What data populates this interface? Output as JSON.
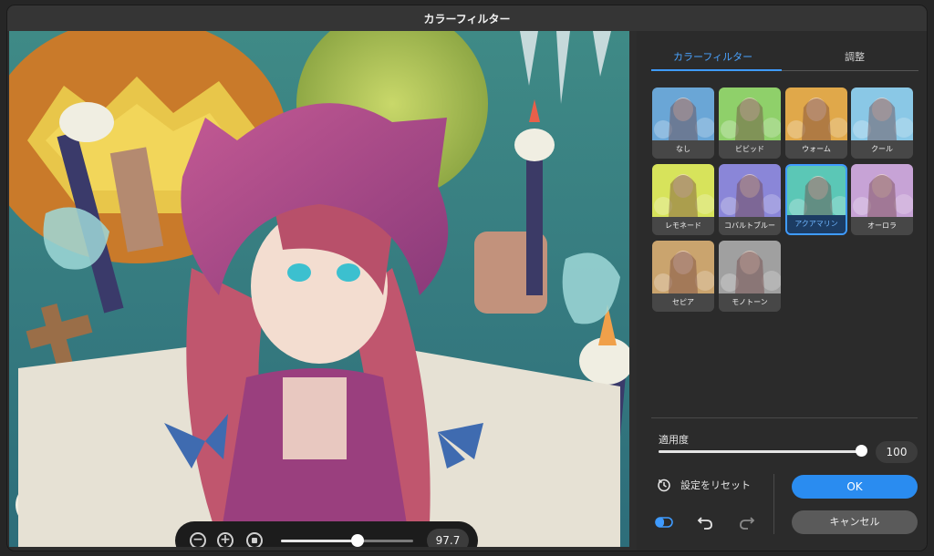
{
  "window": {
    "title": "カラーフィルター"
  },
  "zoom": {
    "minus_label": "−",
    "plus_label": "+",
    "value": "97.7",
    "slider_fraction": 0.58
  },
  "tabs": [
    {
      "label": "カラーフィルター",
      "active": true
    },
    {
      "label": "調整",
      "active": false
    }
  ],
  "filters": [
    {
      "label": "なし",
      "tint": "#6aa6d6",
      "selected": false
    },
    {
      "label": "ビビッド",
      "tint": "#8fd06a",
      "selected": false
    },
    {
      "label": "ウォーム",
      "tint": "#e0a94a",
      "selected": false
    },
    {
      "label": "クール",
      "tint": "#8ac8e6",
      "selected": false
    },
    {
      "label": "レモネード",
      "tint": "#d7e35b",
      "selected": false
    },
    {
      "label": "コバルトブルー",
      "tint": "#8a86d8",
      "selected": false
    },
    {
      "label": "アクアマリン",
      "tint": "#5bc7b6",
      "selected": true
    },
    {
      "label": "オーロラ",
      "tint": "#c7a3d6",
      "selected": false
    },
    {
      "label": "セピア",
      "tint": "#caa46e",
      "selected": false
    },
    {
      "label": "モノトーン",
      "tint": "#a0a0a0",
      "selected": false
    }
  ],
  "apply": {
    "label": "適用度",
    "value": "100",
    "fraction": 1.0
  },
  "reset": {
    "label": "設定をリセット"
  },
  "buttons": {
    "ok": "OK",
    "cancel": "キャンセル"
  },
  "colors": {
    "accent": "#2a8cf0",
    "selected_border": "#3f9bff"
  },
  "icons": {
    "reset": "clock-reset-icon",
    "compare": "compare-toggle-icon",
    "undo": "undo-icon",
    "redo": "redo-icon",
    "zoom_out": "zoom-out-icon",
    "zoom_in": "zoom-in-icon",
    "fit": "fit-screen-icon"
  }
}
